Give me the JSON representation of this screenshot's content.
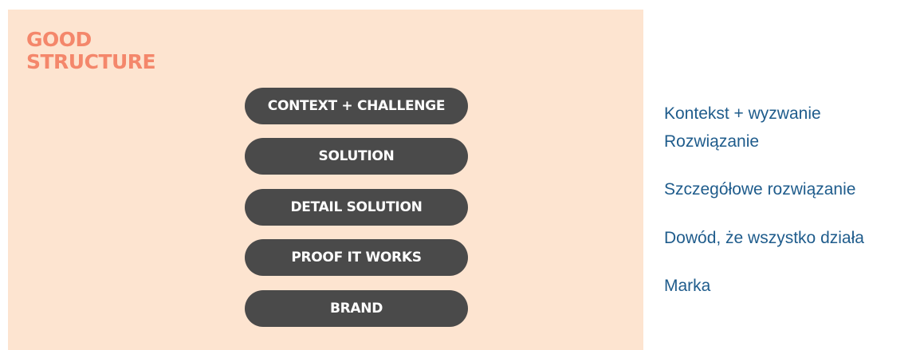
{
  "panel": {
    "title_line1": "GOOD",
    "title_line2": "STRUCTURE",
    "title_color": "#f4876b",
    "background": "#fde4d0",
    "pill_color": "#4a4a4a",
    "steps": [
      "CONTEXT + CHALLENGE",
      "SOLUTION",
      "DETAIL SOLUTION",
      "PROOF IT WORKS",
      "BRAND"
    ]
  },
  "translations": {
    "color": "#1f5c8c",
    "items": [
      "Kontekst + wyzwanie",
      "Rozwiązanie",
      "Szczegółowe rozwiązanie",
      "Dowód, że wszystko działa",
      "Marka"
    ]
  }
}
